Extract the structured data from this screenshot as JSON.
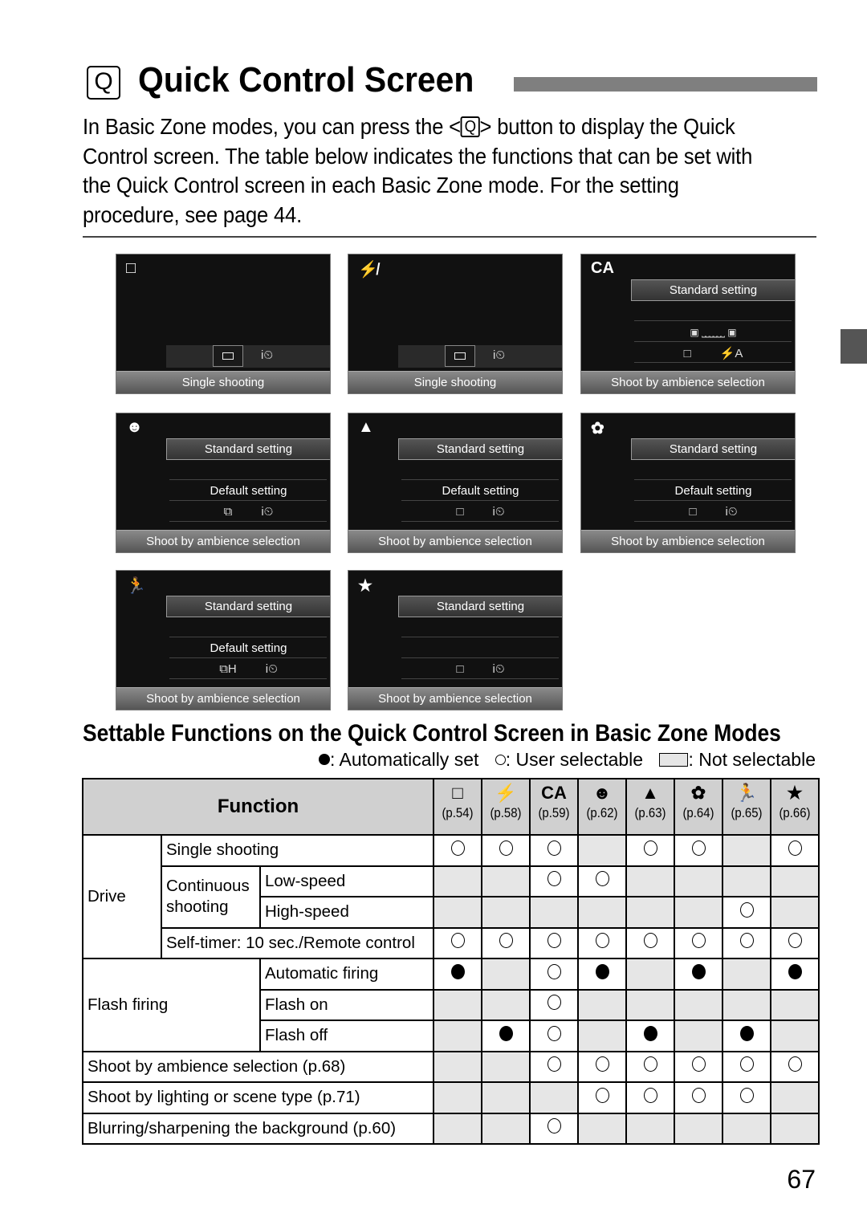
{
  "header": {
    "q_icon": "Q",
    "title": "Quick Control Screen",
    "intro_before": "In Basic Zone modes, you can press the <",
    "intro_q": "Q",
    "intro_after": "> button to display the Quick Control screen. The table below indicates the functions that can be set with the Quick Control screen in each Basic Zone mode. For the setting procedure, see page 44."
  },
  "screens": [
    {
      "mode_icon": "□",
      "mode": "Scene Intelligent Auto",
      "bottom": "Single shooting",
      "type": "drive",
      "drive_icon": "□",
      "timer_icon": "i⏲"
    },
    {
      "mode_icon": "⚡̸",
      "mode": "Flash Off",
      "bottom": "Single shooting",
      "type": "drive",
      "drive_icon": "□",
      "timer_icon": "i⏲"
    },
    {
      "mode_icon": "CA",
      "mode": "Creative Auto",
      "bottom": "Shoot by ambience selection",
      "type": "ca",
      "standard": "Standard setting",
      "slider": "▣ ⎵⎵⎵⎵⎵⎵ ▣",
      "drive_icon": "□",
      "flash_icon": "⚡A"
    },
    {
      "mode_icon": "☻",
      "mode": "Portrait",
      "bottom": "Shoot by ambience selection",
      "type": "scene",
      "standard": "Standard setting",
      "default": "Default setting",
      "drive_icon": "⧉",
      "timer_icon": "i⏲"
    },
    {
      "mode_icon": "▲",
      "mode": "Landscape",
      "bottom": "Shoot by ambience selection",
      "type": "scene",
      "standard": "Standard setting",
      "default": "Default setting",
      "drive_icon": "□",
      "timer_icon": "i⏲"
    },
    {
      "mode_icon": "✿",
      "mode": "Close-up",
      "bottom": "Shoot by ambience selection",
      "type": "scene",
      "standard": "Standard setting",
      "default": "Default setting",
      "drive_icon": "□",
      "timer_icon": "i⏲"
    },
    {
      "mode_icon": "🏃",
      "mode": "Sports",
      "bottom": "Shoot by ambience selection",
      "type": "scene",
      "standard": "Standard setting",
      "default": "Default setting",
      "drive_icon": "⧉H",
      "timer_icon": "i⏲"
    },
    {
      "mode_icon": "★",
      "mode": "Night Portrait",
      "bottom": "Shoot by ambience selection",
      "type": "night",
      "standard": "Standard setting",
      "drive_icon": "□",
      "timer_icon": "i⏲"
    }
  ],
  "section": {
    "title": "Settable Functions on the Quick Control Screen in Basic Zone Modes",
    "legend_auto": ": Automatically set",
    "legend_user": ": User selectable",
    "legend_not": ": Not selectable"
  },
  "table": {
    "function_header": "Function",
    "modes": [
      {
        "icon": "□",
        "page": "(p.54)"
      },
      {
        "icon": "⚡",
        "page": "(p.58)"
      },
      {
        "icon": "CA",
        "page": "(p.59)"
      },
      {
        "icon": "☻",
        "page": "(p.62)"
      },
      {
        "icon": "▲",
        "page": "(p.63)"
      },
      {
        "icon": "✿",
        "page": "(p.64)"
      },
      {
        "icon": "🏃",
        "page": "(p.65)"
      },
      {
        "icon": "★",
        "page": "(p.66)"
      }
    ],
    "groups": {
      "drive": "Drive",
      "continuous": "Continuous shooting",
      "flash": "Flash firing"
    },
    "rows": [
      {
        "label": "Single shooting",
        "values": [
          "o",
          "o",
          "o",
          "-",
          "o",
          "o",
          "-",
          "o"
        ]
      },
      {
        "label": "Low-speed",
        "values": [
          "-",
          "-",
          "o",
          "o",
          "-",
          "-",
          "-",
          "-"
        ]
      },
      {
        "label": "High-speed",
        "values": [
          "-",
          "-",
          "-",
          "-",
          "-",
          "-",
          "o",
          "-"
        ]
      },
      {
        "label": "Self-timer: 10 sec./Remote control",
        "values": [
          "o",
          "o",
          "o",
          "o",
          "o",
          "o",
          "o",
          "o"
        ]
      },
      {
        "label": "Automatic firing",
        "values": [
          "f",
          "-",
          "o",
          "f",
          "-",
          "f",
          "-",
          "f"
        ]
      },
      {
        "label": "Flash on",
        "values": [
          "-",
          "-",
          "o",
          "-",
          "-",
          "-",
          "-",
          "-"
        ]
      },
      {
        "label": "Flash off",
        "values": [
          "-",
          "f",
          "o",
          "-",
          "f",
          "-",
          "f",
          "-"
        ]
      },
      {
        "label": "Shoot by ambience selection (p.68)",
        "values": [
          "-",
          "-",
          "o",
          "o",
          "o",
          "o",
          "o",
          "o"
        ]
      },
      {
        "label": "Shoot by lighting or scene type (p.71)",
        "values": [
          "-",
          "-",
          "-",
          "o",
          "o",
          "o",
          "o",
          "-"
        ]
      },
      {
        "label": "Blurring/sharpening the background (p.60)",
        "values": [
          "-",
          "-",
          "o",
          "-",
          "-",
          "-",
          "-",
          "-"
        ]
      }
    ]
  },
  "page_number": "67"
}
